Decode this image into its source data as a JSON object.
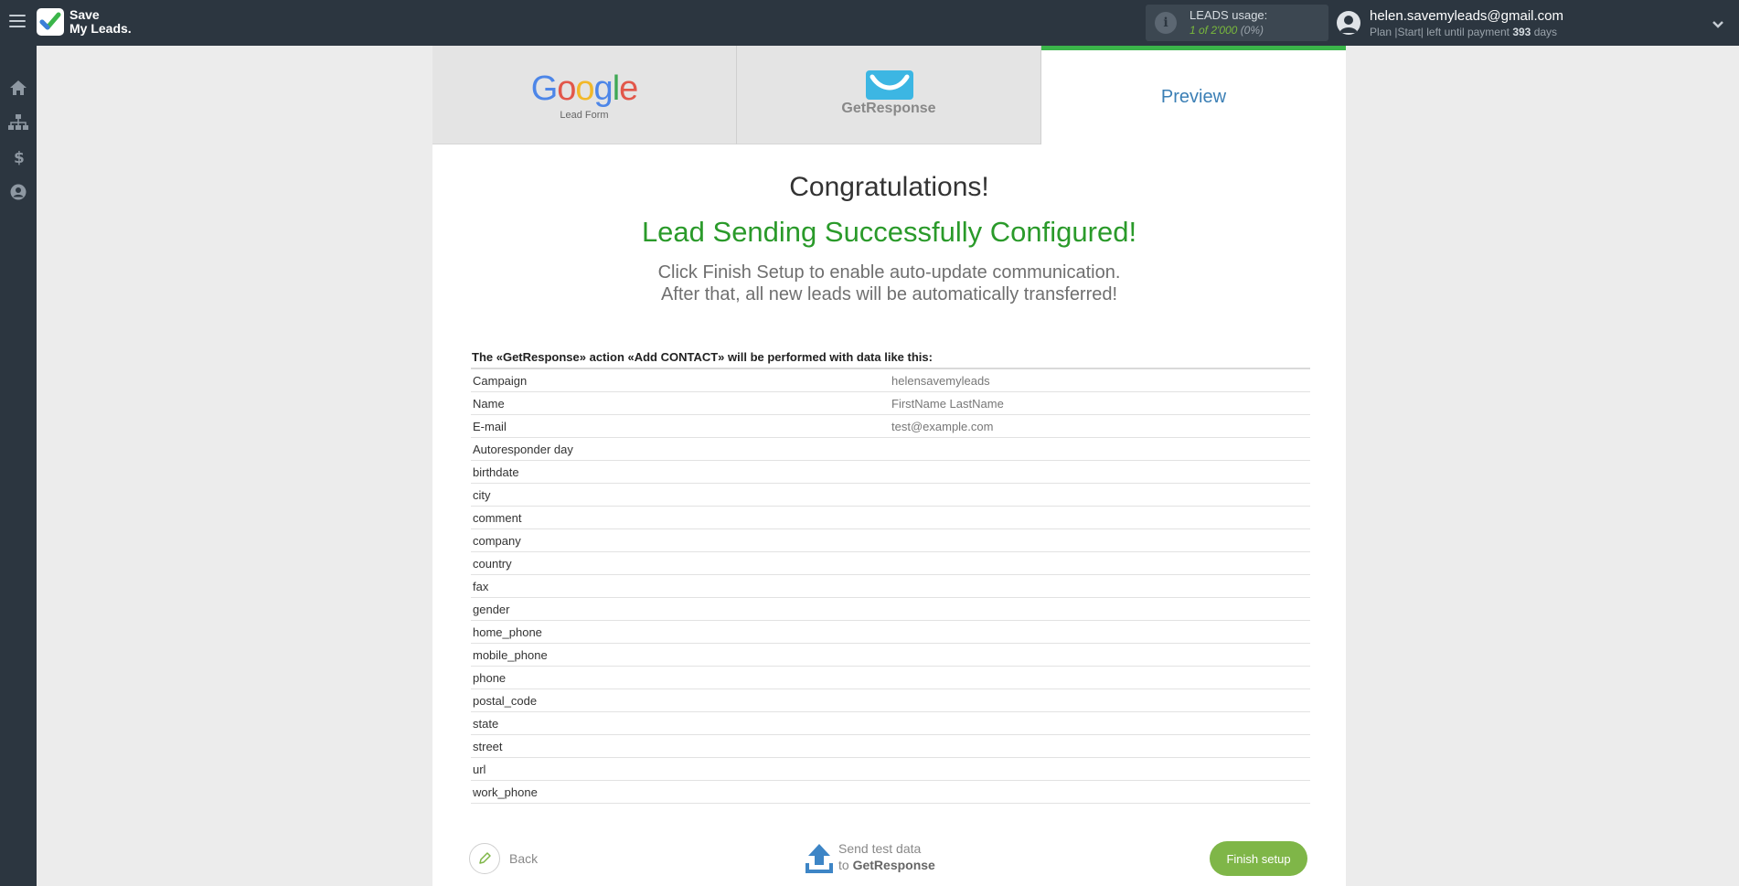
{
  "header": {
    "logo_line1": "Save",
    "logo_line2": "My Leads.",
    "usage_label": "LEADS usage:",
    "usage_value": "1 of 2'000",
    "usage_pct": "(0%)",
    "user_email": "helen.savemyleads@gmail.com",
    "plan_prefix": "Plan |Start| left until payment",
    "plan_days": "393",
    "plan_suffix": "days"
  },
  "sidebar": {
    "items": [
      {
        "icon": "home-icon"
      },
      {
        "icon": "sitemap-icon"
      },
      {
        "icon": "dollar-icon"
      },
      {
        "icon": "user-circle-icon"
      }
    ]
  },
  "tabs": {
    "source_name": "Google",
    "source_sub": "Lead Form",
    "destination_name": "GetResponse",
    "preview_label": "Preview"
  },
  "main": {
    "congrats": "Congratulations!",
    "success": "Lead Sending Successfully Configured!",
    "desc_line1": "Click Finish Setup to enable auto-update communication.",
    "desc_line2": "After that, all new leads will be automatically transferred!",
    "table_title": "The «GetResponse» action «Add CONTACT» will be performed with data like this:",
    "rows": [
      {
        "key": "Campaign",
        "value": "helensavemyleads"
      },
      {
        "key": "Name",
        "value": "FirstName LastName"
      },
      {
        "key": "E-mail",
        "value": "test@example.com"
      },
      {
        "key": "Autoresponder day",
        "value": ""
      },
      {
        "key": "birthdate",
        "value": ""
      },
      {
        "key": "city",
        "value": ""
      },
      {
        "key": "comment",
        "value": ""
      },
      {
        "key": "company",
        "value": ""
      },
      {
        "key": "country",
        "value": ""
      },
      {
        "key": "fax",
        "value": ""
      },
      {
        "key": "gender",
        "value": ""
      },
      {
        "key": "home_phone",
        "value": ""
      },
      {
        "key": "mobile_phone",
        "value": ""
      },
      {
        "key": "phone",
        "value": ""
      },
      {
        "key": "postal_code",
        "value": ""
      },
      {
        "key": "state",
        "value": ""
      },
      {
        "key": "street",
        "value": ""
      },
      {
        "key": "url",
        "value": ""
      },
      {
        "key": "work_phone",
        "value": ""
      }
    ]
  },
  "footer": {
    "back_label": "Back",
    "send_line1": "Send test data",
    "send_to": "to",
    "send_target": "GetResponse",
    "finish_label": "Finish setup"
  },
  "colors": {
    "topbar": "#2c3640",
    "success_green": "#2a9a2a",
    "finish_button": "#7fb648",
    "active_tab_border": "#3bb54a",
    "preview_blue": "#3b7fb5"
  }
}
